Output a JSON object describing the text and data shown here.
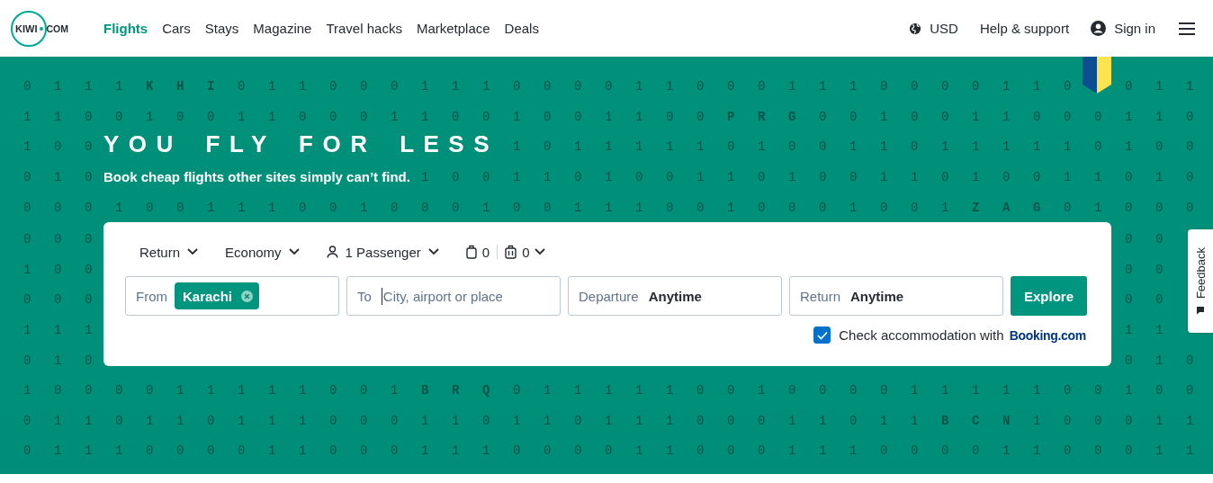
{
  "header": {
    "logo": {
      "left": "KIWI",
      "right": "COM"
    },
    "nav": [
      {
        "label": "Flights",
        "selected": true
      },
      {
        "label": "Cars",
        "selected": false
      },
      {
        "label": "Stays",
        "selected": false
      },
      {
        "label": "Magazine",
        "selected": false
      },
      {
        "label": "Travel hacks",
        "selected": false
      },
      {
        "label": "Marketplace",
        "selected": false
      },
      {
        "label": "Deals",
        "selected": false
      }
    ],
    "currency": "USD",
    "help": "Help & support",
    "sign_in": "Sign in"
  },
  "hero": {
    "title": "YOU FLY FOR LESS",
    "subtitle": "Book cheap flights other sites simply can’t find.",
    "pattern": [
      {
        "kind": "full",
        "text": "0 1 1 1 **K H I** 0 1 1 0 0 0 1 1 1 0 0 0 0 1 1 0 0 0 1 1 1 0 0 0 0 1 1 0   0 1 1"
      },
      {
        "kind": "full",
        "text": "1 1 0 0 1 0 0 1 1 0 0 0 1 1 0 0 1 0 0 1 1 0 0 **P R G** 0 0 1 0 0 1 1 0 0 0 1 1 0"
      },
      {
        "kind": "edges",
        "left": "1 0 0",
        "right": "1 0 1 1 1 1 1 0 1 0 0 1 1 0 1 1 1 1 1 0 1 0 0"
      },
      {
        "kind": "edges",
        "left": "0 1 0",
        "right": "1 0 0 1 1 0 1 0 0 1 1 0 1 0 0 1 1 0 1 0 0 1 1 0 1 0"
      },
      {
        "kind": "full",
        "text": "0 0 0 1 0 0 1 1 1 0 0 1 0 0 0 1 0 0 1 1 1 0 0 1 0 0 0 1 0 0 1 **Z A G** 0 1 0 0 0"
      },
      {
        "kind": "split",
        "left": "0 0 0",
        "right": "0 0"
      },
      {
        "kind": "split",
        "left": "1 0 0",
        "right": "0 0"
      },
      {
        "kind": "split",
        "left": "0 0 0",
        "right": "0 0"
      },
      {
        "kind": "split",
        "left": "1 1 1",
        "right": "1 1"
      },
      {
        "kind": "split",
        "left": "0 1 0",
        "right": "0 1 0"
      },
      {
        "kind": "full",
        "text": "1 0 0 0 0 1 1 1 1 1 0 0 1 **B R Q** 0 1 1 1 1 1 0 0 1 0 0 0 0 1 1 1 1 1 0 0 1 0 0"
      },
      {
        "kind": "full",
        "text": "0 1 1 0 1 1 0 1 1 1 0 0 0 1 1 0 1 1 0 1 1 1 0 0 0 1 1 0 1 1 **B C N** 1 0 0 0 1 1"
      },
      {
        "kind": "full",
        "text": "0 1 1 1 0 0 0 0 1 1 0 0 0 1 1 1 0 0 0 0 1 1 0 0 0 1 1 1 0 0 0 0 1 1 0 0 0 1 1"
      }
    ]
  },
  "search": {
    "options": [
      {
        "kind": "select",
        "label": "Return"
      },
      {
        "kind": "select",
        "label": "Economy"
      },
      {
        "kind": "passengers",
        "label": "1 Passenger"
      }
    ],
    "bags": {
      "cabin": "0",
      "checked": "0"
    },
    "fields": [
      {
        "kind": "chips",
        "label": "From",
        "chip": "Karachi"
      },
      {
        "kind": "input",
        "label": "To",
        "placeholder": "City, airport or place"
      },
      {
        "kind": "value",
        "label": "Departure",
        "value": "Anytime"
      },
      {
        "kind": "value",
        "label": "Return",
        "value": "Anytime"
      }
    ],
    "submit": "Explore",
    "accommodation": {
      "checked": true,
      "text": "Check accommodation with",
      "link": "Booking.com"
    }
  },
  "feedback": "Feedback"
}
